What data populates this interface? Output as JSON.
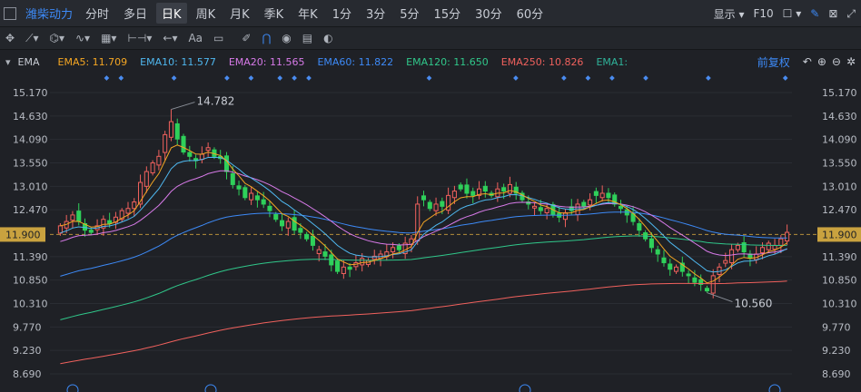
{
  "topbar": {
    "stock_name": "潍柴动力",
    "tabs": [
      "分时",
      "多日",
      "日K",
      "周K",
      "月K",
      "季K",
      "年K",
      "1分",
      "3分",
      "5分",
      "15分",
      "30分",
      "60分"
    ],
    "active_tab": "日K",
    "display_label": "显示",
    "f10_label": "F10"
  },
  "toolbar": {
    "text_tool": "Aa"
  },
  "ema_bar": {
    "label": "EMA",
    "items": [
      {
        "text": "EMA5: 11.709",
        "color": "#f5a623"
      },
      {
        "text": "EMA10: 11.577",
        "color": "#4fb8f0"
      },
      {
        "text": "EMA20: 11.565",
        "color": "#d77ae8"
      },
      {
        "text": "EMA60: 11.822",
        "color": "#3d8af7"
      },
      {
        "text": "EMA120: 11.650",
        "color": "#30c78a"
      },
      {
        "text": "EMA250: 10.826",
        "color": "#f0615d"
      },
      {
        "text": "EMA1:",
        "color": "#2fb39a"
      }
    ],
    "adjust_label": "前复权"
  },
  "chart_data": {
    "type": "candlestick",
    "price_ticks": [
      15.17,
      14.63,
      14.09,
      13.55,
      13.01,
      12.47,
      11.9,
      11.39,
      10.85,
      10.31,
      9.77,
      9.23,
      8.69
    ],
    "ylim": [
      8.69,
      15.17
    ],
    "current_price": 11.9,
    "annotations": [
      {
        "text": "14.782",
        "kind": "high"
      },
      {
        "text": "10.560",
        "kind": "low"
      }
    ],
    "colors": {
      "up": "#f0615d",
      "down": "#2fd05a",
      "ema5": "#f5a623",
      "ema10": "#4fb8f0",
      "ema20": "#d77ae8",
      "ema60": "#3d8af7",
      "ema120": "#30c78a",
      "ema250": "#f0615d"
    },
    "closes": [
      12.1,
      12.2,
      12.35,
      12.2,
      12.0,
      11.95,
      12.1,
      12.25,
      12.15,
      12.3,
      12.45,
      12.5,
      12.65,
      13.1,
      13.35,
      13.55,
      13.7,
      14.2,
      14.5,
      14.1,
      13.8,
      13.7,
      13.6,
      13.75,
      13.9,
      13.7,
      13.65,
      13.35,
      13.05,
      12.95,
      12.75,
      12.85,
      12.7,
      12.6,
      12.45,
      12.25,
      12.1,
      12.2,
      12.0,
      11.95,
      11.8,
      11.65,
      11.55,
      11.4,
      11.2,
      11.05,
      11.15,
      11.1,
      11.25,
      11.35,
      11.3,
      11.4,
      11.45,
      11.5,
      11.6,
      11.55,
      11.7,
      11.8,
      12.6,
      12.7,
      12.5,
      12.6,
      12.55,
      12.8,
      12.9,
      12.95,
      12.85,
      12.8,
      12.95,
      12.9,
      12.8,
      12.95,
      12.9,
      13.05,
      12.85,
      12.7,
      12.6,
      12.55,
      12.45,
      12.5,
      12.35,
      12.3,
      12.4,
      12.45,
      12.6,
      12.55,
      12.7,
      12.8,
      12.85,
      12.75,
      12.6,
      12.5,
      12.35,
      12.2,
      12.0,
      11.8,
      11.6,
      11.45,
      11.25,
      11.1,
      11.15,
      11.05,
      10.95,
      10.8,
      10.75,
      10.6,
      10.95,
      11.15,
      11.3,
      11.55,
      11.65,
      11.5,
      11.35,
      11.45,
      11.6,
      11.7,
      11.65,
      11.8,
      11.95
    ],
    "ema_last": {
      "ema5": 11.709,
      "ema10": 11.577,
      "ema20": 11.565,
      "ema60": 11.822,
      "ema120": 11.65,
      "ema250": 10.826
    }
  }
}
